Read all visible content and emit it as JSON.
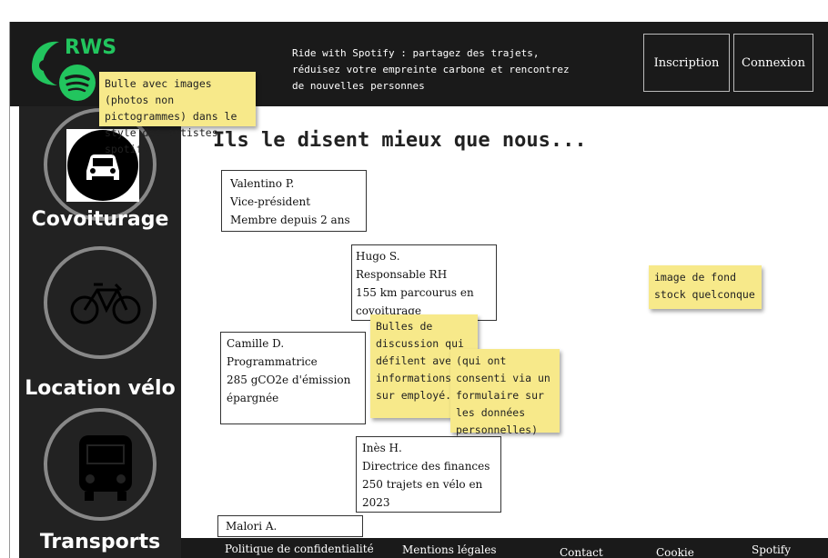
{
  "header": {
    "brand": "RWS",
    "tagline": "Ride with Spotify : partagez des trajets, réduisez votre empreinte carbone et rencontrez de nouvelles personnes",
    "signup_label": "Inscription",
    "login_label": "Connexion"
  },
  "sidebar": {
    "items": [
      {
        "label": "Covoiturage",
        "icon": "car-icon"
      },
      {
        "label": "Location vélo",
        "icon": "bicycle-icon"
      },
      {
        "label": "Transports",
        "icon": "bus-icon"
      }
    ]
  },
  "main": {
    "title": "Ils le disent mieux que nous...",
    "testimonials": [
      {
        "name": "Valentino P.",
        "role": "Vice-président",
        "stat": "Membre depuis 2 ans"
      },
      {
        "name": "Hugo S.",
        "role": "Responsable RH",
        "stat": "155 km parcourus en covoiturage"
      },
      {
        "name": "Camille D.",
        "role": "Programmatrice",
        "stat": "285 gCO2e d'émission épargnée"
      },
      {
        "name": "Inès H.",
        "role": "Directrice des finances",
        "stat": "250 trajets en vélo en 2023"
      },
      {
        "name": "Malori A.",
        "role": "",
        "stat": ""
      }
    ]
  },
  "notes": {
    "bubble": "Bulle avec images (photos non pictogrammes) dans le style des artistes spotify",
    "background": "image de fond stock quelconque",
    "discussion": "Bulles de discussion qui défilent avec informations sur employé.es",
    "consent": "(qui ont consenti via un formulaire sur les données personnelles)"
  },
  "footer": {
    "links": [
      "Politique de confidentialité",
      "Mentions légales",
      "Contact",
      "Cookie",
      "Spotify"
    ]
  },
  "colors": {
    "header_bg": "#1a1a1a",
    "brand": "#22c55e",
    "sticky": "#f7e98a"
  }
}
